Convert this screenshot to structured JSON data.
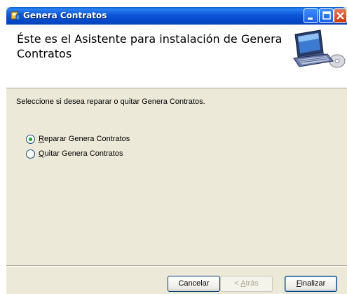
{
  "window": {
    "title": "Genera Contratos",
    "title_icon": "installer-icon",
    "controls": [
      "minimize-icon",
      "maximize-icon",
      "close-icon"
    ]
  },
  "header": {
    "title": "Éste es el Asistente para instalación de Genera Contratos",
    "graphic": "computer-cd-icon"
  },
  "body": {
    "instruction": "Seleccione si desea reparar o quitar Genera Contratos.",
    "options": [
      {
        "accel": "R",
        "rest": "eparar Genera Contratos",
        "selected": true
      },
      {
        "accel": "Q",
        "rest": "uitar Genera Contratos",
        "selected": false
      }
    ]
  },
  "buttons": {
    "cancel": "Cancelar",
    "back_accel": "A",
    "back_prefix": "< ",
    "back_rest": "trás",
    "finish_accel": "F",
    "finish_rest": "inalizar",
    "back_enabled": false
  },
  "colors": {
    "titlebar": "#0249c8",
    "dialog_bg": "#ece9d8",
    "radio_selected": "#21a121"
  }
}
